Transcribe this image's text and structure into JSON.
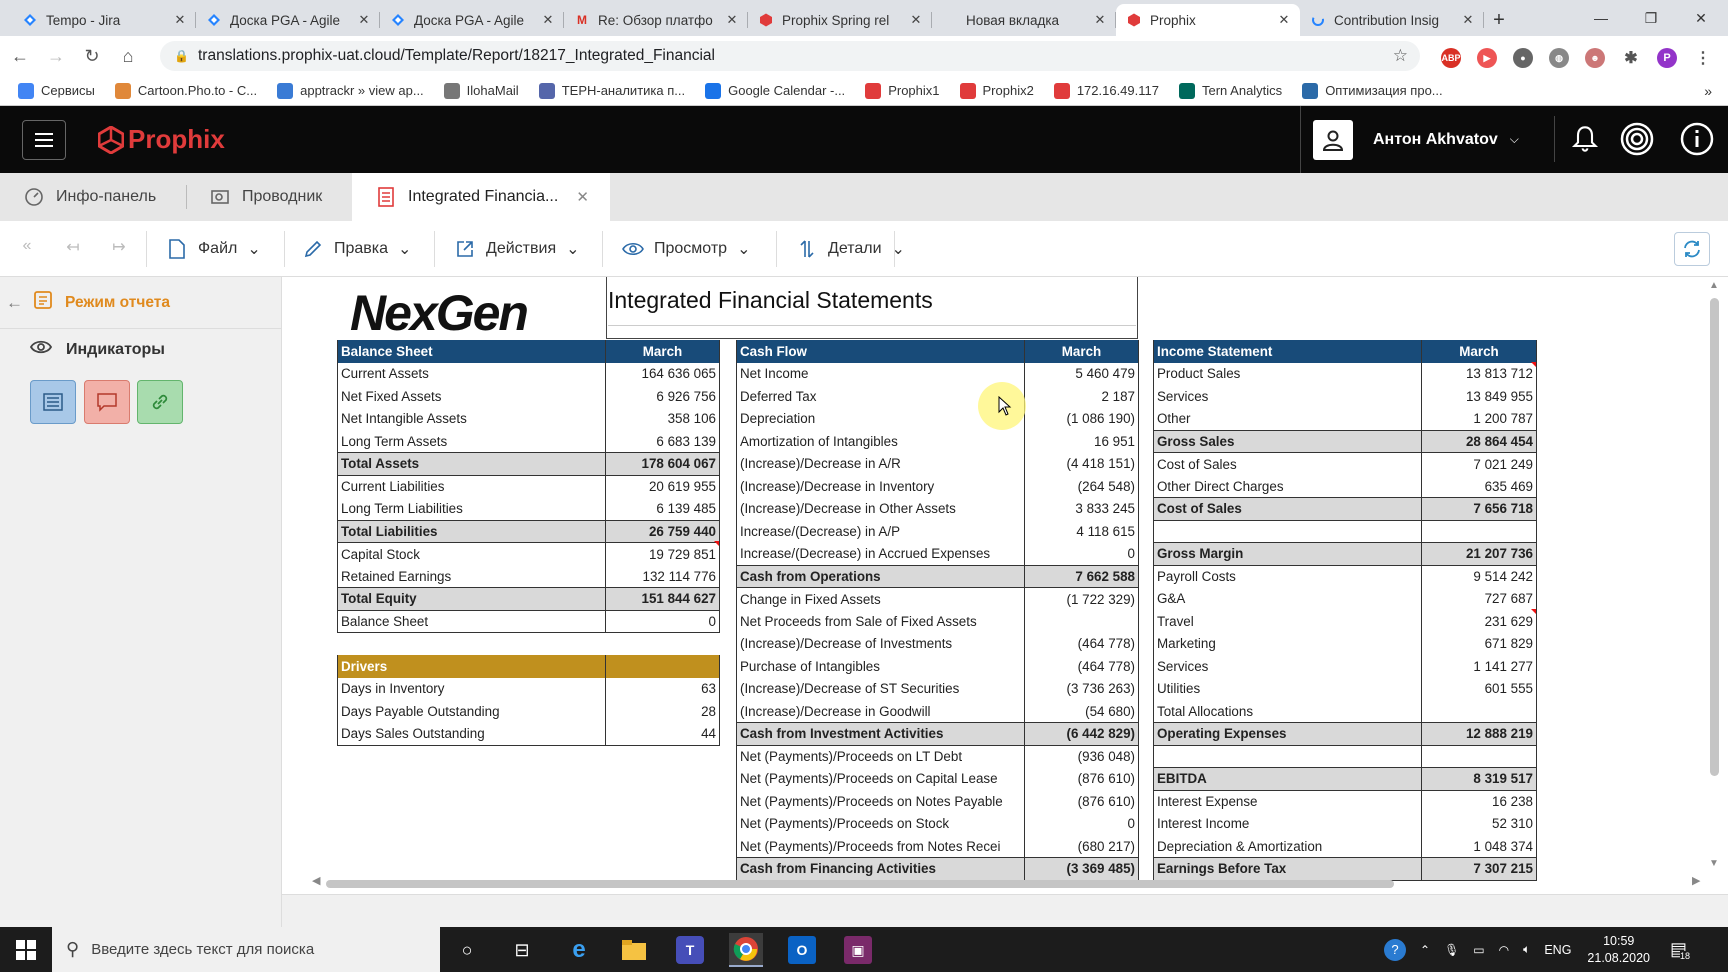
{
  "browser": {
    "tabs": [
      {
        "title": "Tempo - Jira",
        "favicon": "jira-icon",
        "color": "#2684ff"
      },
      {
        "title": "Доска PGA - Agile",
        "favicon": "jira-icon",
        "color": "#2684ff"
      },
      {
        "title": "Доска PGA - Agile",
        "favicon": "jira-icon",
        "color": "#2684ff"
      },
      {
        "title": "Re: Обзор платфо",
        "favicon": "gmail-icon",
        "color": "#d93025"
      },
      {
        "title": "Prophix Spring rel",
        "favicon": "prophix-icon",
        "color": "#e03b3b"
      },
      {
        "title": "Новая вкладка",
        "favicon": "",
        "color": ""
      },
      {
        "title": "Prophix",
        "favicon": "prophix-icon",
        "color": "#e03b3b",
        "active": true
      },
      {
        "title": "Contribution Insig",
        "favicon": "loading-icon",
        "color": "#2684ff"
      }
    ],
    "url": "translations.prophix-uat.cloud/Template/Report/18217_Integrated_Financial",
    "profile_initial": "P",
    "bookmarks": [
      {
        "label": "Сервисы",
        "icon": "apps-icon"
      },
      {
        "label": "Cartoon.Pho.to - C...",
        "icon": "cartoon-icon"
      },
      {
        "label": "apptrackr » view ap...",
        "icon": "apptrackr-icon"
      },
      {
        "label": "IlohaMail",
        "icon": "mail-icon"
      },
      {
        "label": "ТЕРН-аналитика п...",
        "icon": "analytics-icon"
      },
      {
        "label": "Google Calendar -...",
        "icon": "calendar-icon"
      },
      {
        "label": "Prophix1",
        "icon": "prophix-icon"
      },
      {
        "label": "Prophix2",
        "icon": "prophix-icon"
      },
      {
        "label": "172.16.49.117",
        "icon": "prophix-icon"
      },
      {
        "label": "Tern Analytics",
        "icon": "tern-icon"
      },
      {
        "label": "Оптимизация про...",
        "icon": "optimize-icon"
      }
    ]
  },
  "app": {
    "logo": "Prophix",
    "user_name": "Антон Akhvatov",
    "tabs": [
      "Инфо-панель",
      "Проводник",
      "Integrated Financia..."
    ],
    "toolbar": [
      "Файл",
      "Правка",
      "Действия",
      "Просмотр",
      "Детали"
    ],
    "sidebar": {
      "mode_title": "Режим отчета",
      "indicators": "Индикаторы"
    }
  },
  "report": {
    "company_logo": "NexGen",
    "title": "Integrated Financial Statements",
    "balance_sheet": {
      "header": [
        "Balance Sheet",
        "March"
      ],
      "rows": [
        {
          "label": "Current Assets",
          "value": "164 636 065"
        },
        {
          "label": "Net Fixed Assets",
          "value": "6 926 756"
        },
        {
          "label": "Net Intangible Assets",
          "value": "358 106"
        },
        {
          "label": "Long Term Assets",
          "value": "6 683 139"
        },
        {
          "label": "Total Assets",
          "value": "178 604 067",
          "total": true
        },
        {
          "label": "Current Liabilities",
          "value": "20 619 955"
        },
        {
          "label": "Long Term Liabilities",
          "value": "6 139 485"
        },
        {
          "label": "Total Liabilities",
          "value": "26 759 440",
          "total": true
        },
        {
          "label": "Capital Stock",
          "value": "19 729 851"
        },
        {
          "label": "Retained Earnings",
          "value": "132 114 776"
        },
        {
          "label": "Total Equity",
          "value": "151 844 627",
          "total": true
        },
        {
          "label": "Balance Sheet",
          "value": "0"
        }
      ]
    },
    "drivers": {
      "header": [
        "Drivers",
        ""
      ],
      "rows": [
        {
          "label": "Days in Inventory",
          "value": "63"
        },
        {
          "label": "Days Payable Outstanding",
          "value": "28"
        },
        {
          "label": "Days Sales Outstanding",
          "value": "44"
        }
      ]
    },
    "cash_flow": {
      "header": [
        "Cash Flow",
        "March"
      ],
      "rows": [
        {
          "label": "Net Income",
          "value": "5 460 479"
        },
        {
          "label": "Deferred Tax",
          "value": "2 187"
        },
        {
          "label": "Depreciation",
          "value": "(1 086 190)"
        },
        {
          "label": "Amortization of Intangibles",
          "value": "16 951"
        },
        {
          "label": "(Increase)/Decrease in A/R",
          "value": "(4 418 151)"
        },
        {
          "label": "(Increase)/Decrease in Inventory",
          "value": "(264 548)"
        },
        {
          "label": "(Increase)/Decrease in Other Assets",
          "value": "3 833 245"
        },
        {
          "label": "Increase/(Decrease) in A/P",
          "value": "4 118 615"
        },
        {
          "label": "Increase/(Decrease) in Accrued Expenses",
          "value": "0"
        },
        {
          "label": "Cash from Operations",
          "value": "7 662 588",
          "total": true
        },
        {
          "label": "Change in Fixed Assets",
          "value": "(1 722 329)"
        },
        {
          "label": "Net Proceeds from Sale of Fixed Assets",
          "value": ""
        },
        {
          "label": "(Increase)/Decrease of Investments",
          "value": "(464 778)"
        },
        {
          "label": "Purchase of Intangibles",
          "value": "(464 778)"
        },
        {
          "label": "(Increase)/Decrease of ST Securities",
          "value": "(3 736 263)"
        },
        {
          "label": "(Increase)/Decrease in Goodwill",
          "value": "(54 680)"
        },
        {
          "label": "Cash from Investment Activities",
          "value": "(6 442 829)",
          "total": true
        },
        {
          "label": "Net (Payments)/Proceeds on LT Debt",
          "value": "(936 048)"
        },
        {
          "label": "Net (Payments)/Proceeds on Capital Lease",
          "value": "(876 610)"
        },
        {
          "label": "Net (Payments)/Proceeds on Notes Payable",
          "value": "(876 610)"
        },
        {
          "label": "Net (Payments)/Proceeds on Stock",
          "value": "0"
        },
        {
          "label": "Net (Payments)/Proceeds from Notes Recei",
          "value": "(680 217)"
        },
        {
          "label": "Cash from Financing Activities",
          "value": "(3 369 485)",
          "total": true
        }
      ]
    },
    "income_statement": {
      "header": [
        "Income Statement",
        "March"
      ],
      "rows": [
        {
          "label": "Product Sales",
          "value": "13 813 712"
        },
        {
          "label": "Services",
          "value": "13 849 955"
        },
        {
          "label": "Other",
          "value": "1 200 787"
        },
        {
          "label": "Gross Sales",
          "value": "28 864 454",
          "total": true
        },
        {
          "label": "Cost of Sales",
          "value": "7 021 249"
        },
        {
          "label": "Other Direct Charges",
          "value": "635 469"
        },
        {
          "label": "Cost of Sales",
          "value": "7 656 718",
          "total": true
        },
        {
          "label": "",
          "value": ""
        },
        {
          "label": "Gross Margin",
          "value": "21 207 736",
          "total": true
        },
        {
          "label": "Payroll Costs",
          "value": "9 514 242"
        },
        {
          "label": "G&A",
          "value": "727 687"
        },
        {
          "label": "Travel",
          "value": "231 629"
        },
        {
          "label": "Marketing",
          "value": "671 829"
        },
        {
          "label": "Services",
          "value": "1 141 277"
        },
        {
          "label": "Utilities",
          "value": "601 555"
        },
        {
          "label": "Total Allocations",
          "value": ""
        },
        {
          "label": "Operating Expenses",
          "value": "12 888 219",
          "total": true
        },
        {
          "label": "",
          "value": ""
        },
        {
          "label": "EBITDA",
          "value": "8 319 517",
          "total": true
        },
        {
          "label": "Interest Expense",
          "value": "16 238"
        },
        {
          "label": "Interest Income",
          "value": "52 310"
        },
        {
          "label": "Depreciation & Amortization",
          "value": "1 048 374"
        },
        {
          "label": "Earnings Before Tax",
          "value": "7 307 215",
          "total": true
        }
      ]
    }
  },
  "taskbar": {
    "search_placeholder": "Введите здесь текст для поиска",
    "lang": "ENG",
    "time": "10:59",
    "date": "21.08.2020",
    "notifications": "18"
  },
  "colors": {
    "table_header": "#184b79",
    "drivers_header": "#c0901e",
    "brand": "#e03b3b",
    "sidebar_accent": "#e08a1e"
  }
}
